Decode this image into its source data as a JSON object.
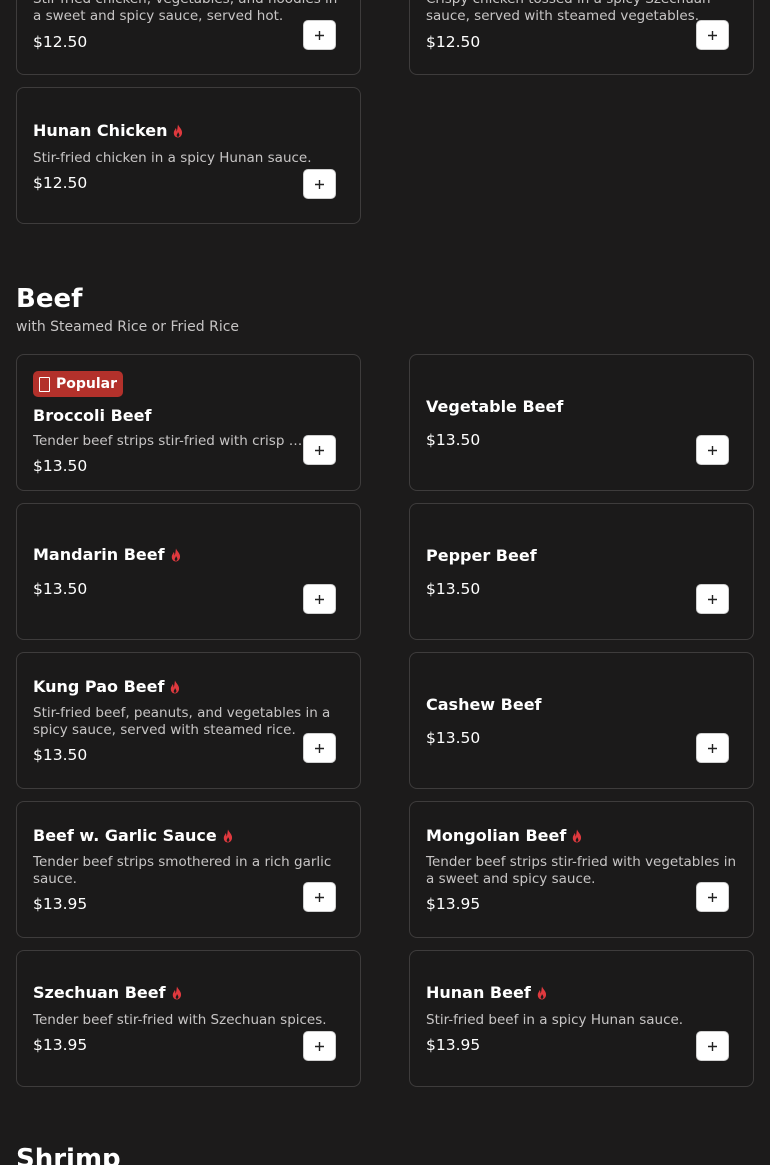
{
  "top_items": [
    {
      "desc": "Stir-fried chicken, vegetables, and noodles in a sweet and spicy sauce, served hot.",
      "price": "$12.50"
    },
    {
      "desc": "Crispy chicken tossed in a spicy Szechuan sauce, served with steamed vegetables.",
      "price": "$12.50"
    },
    {
      "name": "Hunan Chicken",
      "desc": "Stir-fried chicken in a spicy Hunan sauce.",
      "price": "$12.50",
      "spicy": true
    }
  ],
  "beef": {
    "title": "Beef",
    "subtitle": "with Steamed Rice or Fried Rice",
    "items": [
      {
        "name": "Broccoli Beef",
        "desc": "Tender beef strips stir-fried with crisp broccoli in a savory brown sauce.",
        "price": "$13.50",
        "badge": "Popular"
      },
      {
        "name": "Vegetable Beef",
        "price": "$13.50"
      },
      {
        "name": "Mandarin Beef",
        "price": "$13.50",
        "spicy": true
      },
      {
        "name": "Pepper Beef",
        "price": "$13.50"
      },
      {
        "name": "Kung Pao Beef",
        "desc": "Stir-fried beef, peanuts, and vegetables in a spicy sauce, served with steamed rice.",
        "price": "$13.50",
        "spicy": true
      },
      {
        "name": "Cashew Beef",
        "price": "$13.50"
      },
      {
        "name": "Beef w. Garlic Sauce",
        "desc": "Tender beef strips smothered in a rich garlic sauce.",
        "price": "$13.95",
        "spicy": true
      },
      {
        "name": "Mongolian Beef",
        "desc": "Tender beef strips stir-fried with vegetables in a sweet and spicy sauce.",
        "price": "$13.95",
        "spicy": true
      },
      {
        "name": "Szechuan Beef",
        "desc": "Tender beef stir-fried with Szechuan spices.",
        "price": "$13.95",
        "spicy": true
      },
      {
        "name": "Hunan Beef",
        "desc": "Stir-fried beef in a spicy Hunan sauce.",
        "price": "$13.95",
        "spicy": true
      }
    ]
  },
  "next_section": {
    "title": "Shrimp"
  },
  "icons": {
    "spicy": "flame-icon",
    "add": "plus-icon",
    "badge": "popular-badge-icon"
  },
  "colors": {
    "background": "#1c1b1b",
    "card_border": "#3e3c3c",
    "spicy": "#e0393e",
    "badge": "#b3312b"
  }
}
